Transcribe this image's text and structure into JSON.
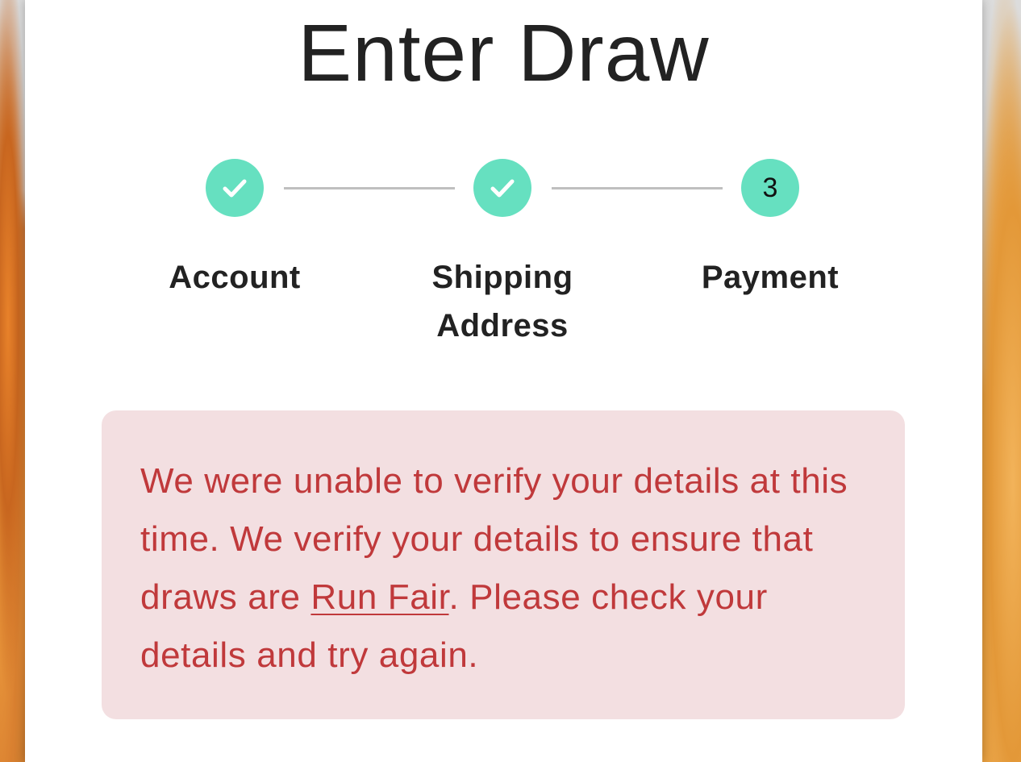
{
  "page": {
    "title": "Enter Draw"
  },
  "stepper": {
    "steps": [
      {
        "label_line1": "Account",
        "label_line2": "",
        "state": "complete",
        "icon": "check-icon"
      },
      {
        "label_line1": "Shipping",
        "label_line2": "Address",
        "state": "complete",
        "icon": "check-icon"
      },
      {
        "label_line1": "Payment",
        "label_line2": "",
        "state": "current",
        "number": "3"
      }
    ],
    "accent_color": "#66e0c0"
  },
  "alert": {
    "text_before_link": "We were unable to verify your details at this time. We verify your details to ensure that draws are ",
    "link_text": "Run Fair",
    "text_after_link": ". Please check your details and try again.",
    "text_color": "#c0393b",
    "background_color": "#f3dfe1"
  }
}
